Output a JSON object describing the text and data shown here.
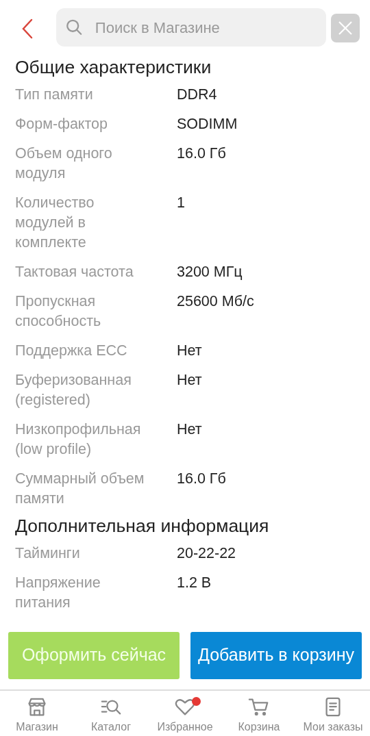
{
  "search": {
    "placeholder": "Поиск в Магазине"
  },
  "sections": [
    {
      "title": "Общие характеристики",
      "rows": [
        {
          "label": "Тип памяти",
          "value": "DDR4"
        },
        {
          "label": "Форм-фактор",
          "value": "SODIMM"
        },
        {
          "label": "Объем одного модуля",
          "value": "16.0 Гб"
        },
        {
          "label": "Количество модулей в комплекте",
          "value": "1"
        },
        {
          "label": "Тактовая частота",
          "value": "3200 МГц"
        },
        {
          "label": "Пропускная способность",
          "value": "25600 Мб/с"
        },
        {
          "label": "Поддержка ECC",
          "value": "Нет"
        },
        {
          "label": "Буферизованная (registered)",
          "value": "Нет"
        },
        {
          "label": "Низкопрофильная (low profile)",
          "value": "Нет"
        },
        {
          "label": "Суммарный объем памяти",
          "value": "16.0 Гб"
        }
      ]
    },
    {
      "title": "Дополнительная информация",
      "rows": [
        {
          "label": "Тайминги",
          "value": "20-22-22"
        },
        {
          "label": "Напряжение питания",
          "value": "1.2 В"
        }
      ]
    }
  ],
  "actions": [
    {
      "label": "Оформить сейчас",
      "kind": "buy"
    },
    {
      "label": "Добавить в корзину",
      "kind": "cart"
    }
  ],
  "bottom_nav": [
    {
      "label": "Магазин",
      "has_notification": false
    },
    {
      "label": "Каталог",
      "has_notification": false
    },
    {
      "label": "Избранное",
      "has_notification": true
    },
    {
      "label": "Корзина",
      "has_notification": false
    },
    {
      "label": "Мои заказы",
      "has_notification": false
    }
  ]
}
